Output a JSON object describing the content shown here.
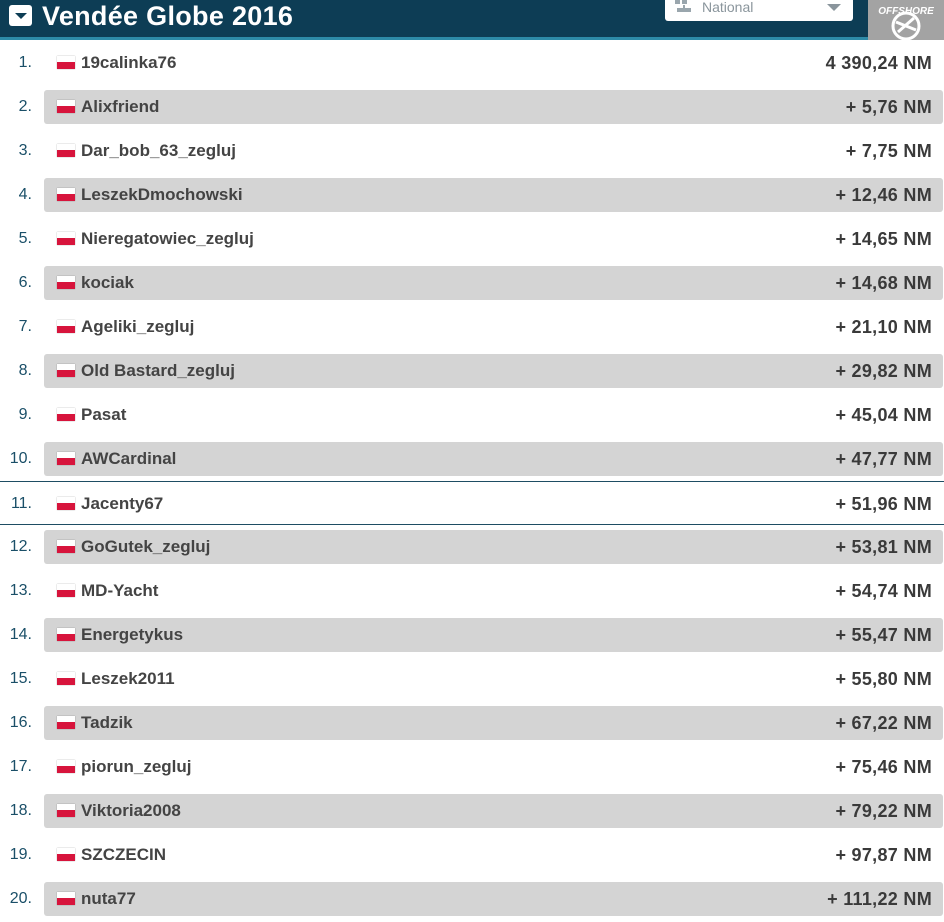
{
  "header": {
    "title": "Vendée Globe 2016",
    "selector_value": "National",
    "logo_text": "OFFSHORE",
    "colors": {
      "bar": "#0d3d55",
      "accent_line": "#2d8ba8",
      "logo_bg": "#a3a3a3"
    }
  },
  "ranking": [
    {
      "rank": "1.",
      "flag": "poland-flag-icon",
      "name": "19calinka76",
      "distance": "4 390,24 NM"
    },
    {
      "rank": "2.",
      "flag": "poland-flag-icon",
      "name": "Alixfriend",
      "distance": "+ 5,76 NM"
    },
    {
      "rank": "3.",
      "flag": "poland-flag-icon",
      "name": "Dar_bob_63_zegluj",
      "distance": "+ 7,75 NM"
    },
    {
      "rank": "4.",
      "flag": "poland-flag-icon",
      "name": "LeszekDmochowski",
      "distance": "+ 12,46 NM"
    },
    {
      "rank": "5.",
      "flag": "poland-flag-icon",
      "name": "Nieregatowiec_zegluj",
      "distance": "+ 14,65 NM"
    },
    {
      "rank": "6.",
      "flag": "poland-flag-icon",
      "name": "kociak",
      "distance": "+ 14,68 NM"
    },
    {
      "rank": "7.",
      "flag": "poland-flag-icon",
      "name": "Ageliki_zegluj",
      "distance": "+ 21,10 NM"
    },
    {
      "rank": "8.",
      "flag": "poland-flag-icon",
      "name": "Old Bastard_zegluj",
      "distance": "+ 29,82 NM"
    },
    {
      "rank": "9.",
      "flag": "poland-flag-icon",
      "name": "Pasat",
      "distance": "+ 45,04 NM"
    },
    {
      "rank": "10.",
      "flag": "poland-flag-icon",
      "name": "AWCardinal",
      "distance": "+ 47,77 NM"
    },
    {
      "rank": "11.",
      "flag": "poland-flag-icon",
      "name": "Jacenty67",
      "distance": "+ 51,96 NM"
    },
    {
      "rank": "12.",
      "flag": "poland-flag-icon",
      "name": "GoGutek_zegluj",
      "distance": "+ 53,81 NM"
    },
    {
      "rank": "13.",
      "flag": "poland-flag-icon",
      "name": "MD-Yacht",
      "distance": "+ 54,74 NM"
    },
    {
      "rank": "14.",
      "flag": "poland-flag-icon",
      "name": "Energetykus",
      "distance": "+ 55,47 NM"
    },
    {
      "rank": "15.",
      "flag": "poland-flag-icon",
      "name": "Leszek2011",
      "distance": "+ 55,80 NM"
    },
    {
      "rank": "16.",
      "flag": "poland-flag-icon",
      "name": "Tadzik",
      "distance": "+ 67,22 NM"
    },
    {
      "rank": "17.",
      "flag": "poland-flag-icon",
      "name": "piorun_zegluj",
      "distance": "+ 75,46 NM"
    },
    {
      "rank": "18.",
      "flag": "poland-flag-icon",
      "name": "Viktoria2008",
      "distance": "+ 79,22 NM"
    },
    {
      "rank": "19.",
      "flag": "poland-flag-icon",
      "name": "SZCZECIN",
      "distance": "+ 97,87 NM"
    },
    {
      "rank": "20.",
      "flag": "poland-flag-icon",
      "name": "nuta77",
      "distance": "+ 111,22 NM"
    }
  ]
}
